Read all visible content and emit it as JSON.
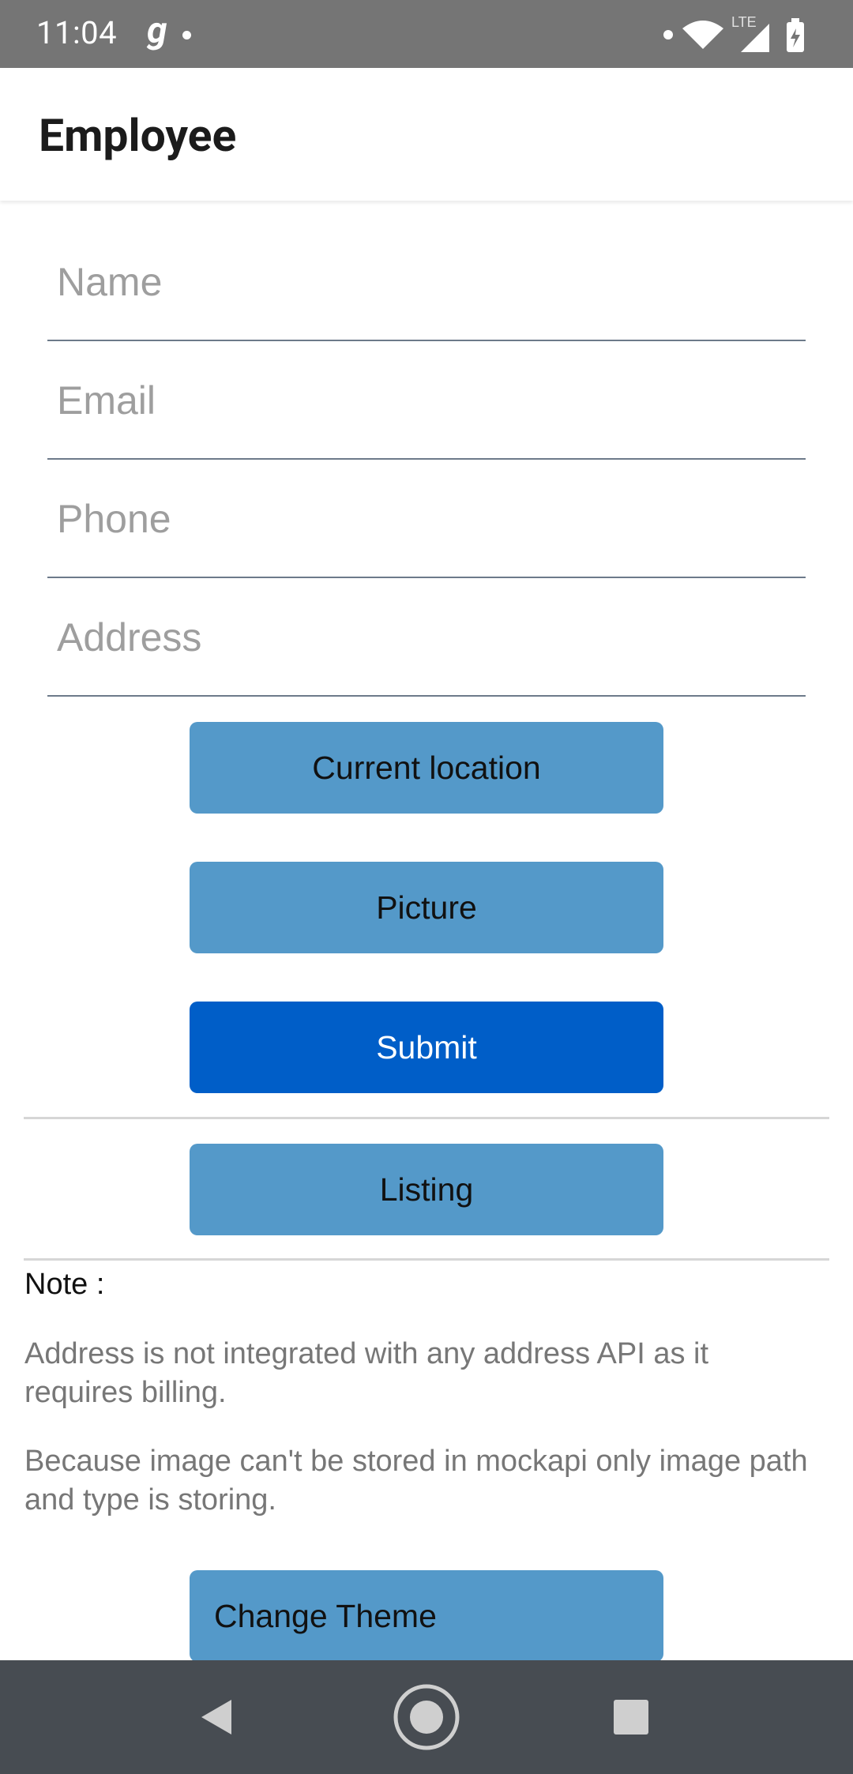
{
  "status_bar": {
    "time": "11:04",
    "notification_icon": "g",
    "network": "LTE"
  },
  "app_bar": {
    "title": "Employee"
  },
  "form": {
    "name_placeholder": "Name",
    "email_placeholder": "Email",
    "phone_placeholder": "Phone",
    "address_placeholder": "Address"
  },
  "buttons": {
    "current_location": "Current location",
    "picture": "Picture",
    "submit": "Submit",
    "listing": "Listing",
    "change_theme": "Change Theme"
  },
  "note": {
    "heading": "Note :",
    "lines": [
      "Address is not integrated with any address API as it requires billing.",
      "Because image can't be stored in mockapi only image path and type is storing."
    ]
  },
  "colors": {
    "status_bar": "#757575",
    "button": "#5499c9",
    "primary_button": "#005ec8",
    "nav_bar": "#474c52"
  },
  "icons": {
    "nav_back": "back-triangle-icon",
    "nav_home": "home-circle-icon",
    "nav_recents": "recents-square-icon"
  }
}
